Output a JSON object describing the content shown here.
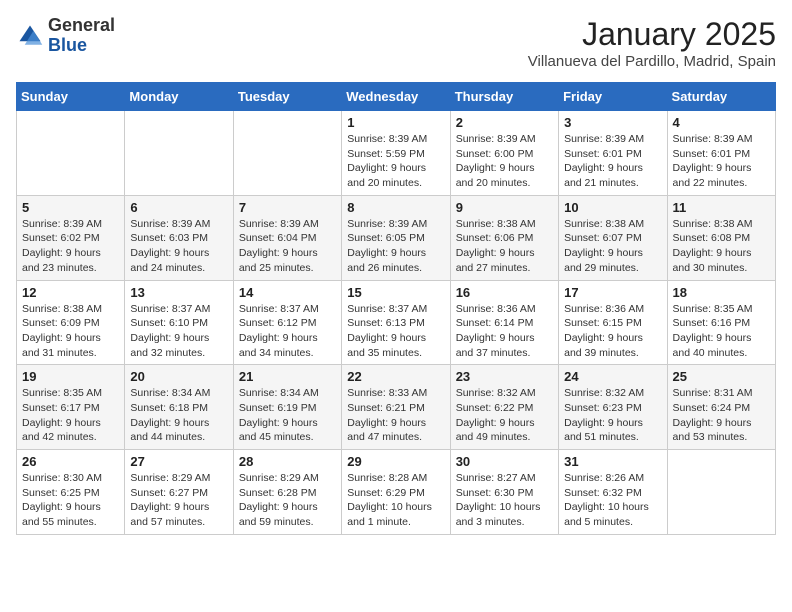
{
  "header": {
    "logo_line1": "General",
    "logo_line2": "Blue",
    "month": "January 2025",
    "location": "Villanueva del Pardillo, Madrid, Spain"
  },
  "days_of_week": [
    "Sunday",
    "Monday",
    "Tuesday",
    "Wednesday",
    "Thursday",
    "Friday",
    "Saturday"
  ],
  "weeks": [
    [
      {
        "day": "",
        "info": ""
      },
      {
        "day": "",
        "info": ""
      },
      {
        "day": "",
        "info": ""
      },
      {
        "day": "1",
        "info": "Sunrise: 8:39 AM\nSunset: 5:59 PM\nDaylight: 9 hours and 20 minutes."
      },
      {
        "day": "2",
        "info": "Sunrise: 8:39 AM\nSunset: 6:00 PM\nDaylight: 9 hours and 20 minutes."
      },
      {
        "day": "3",
        "info": "Sunrise: 8:39 AM\nSunset: 6:01 PM\nDaylight: 9 hours and 21 minutes."
      },
      {
        "day": "4",
        "info": "Sunrise: 8:39 AM\nSunset: 6:01 PM\nDaylight: 9 hours and 22 minutes."
      }
    ],
    [
      {
        "day": "5",
        "info": "Sunrise: 8:39 AM\nSunset: 6:02 PM\nDaylight: 9 hours and 23 minutes."
      },
      {
        "day": "6",
        "info": "Sunrise: 8:39 AM\nSunset: 6:03 PM\nDaylight: 9 hours and 24 minutes."
      },
      {
        "day": "7",
        "info": "Sunrise: 8:39 AM\nSunset: 6:04 PM\nDaylight: 9 hours and 25 minutes."
      },
      {
        "day": "8",
        "info": "Sunrise: 8:39 AM\nSunset: 6:05 PM\nDaylight: 9 hours and 26 minutes."
      },
      {
        "day": "9",
        "info": "Sunrise: 8:38 AM\nSunset: 6:06 PM\nDaylight: 9 hours and 27 minutes."
      },
      {
        "day": "10",
        "info": "Sunrise: 8:38 AM\nSunset: 6:07 PM\nDaylight: 9 hours and 29 minutes."
      },
      {
        "day": "11",
        "info": "Sunrise: 8:38 AM\nSunset: 6:08 PM\nDaylight: 9 hours and 30 minutes."
      }
    ],
    [
      {
        "day": "12",
        "info": "Sunrise: 8:38 AM\nSunset: 6:09 PM\nDaylight: 9 hours and 31 minutes."
      },
      {
        "day": "13",
        "info": "Sunrise: 8:37 AM\nSunset: 6:10 PM\nDaylight: 9 hours and 32 minutes."
      },
      {
        "day": "14",
        "info": "Sunrise: 8:37 AM\nSunset: 6:12 PM\nDaylight: 9 hours and 34 minutes."
      },
      {
        "day": "15",
        "info": "Sunrise: 8:37 AM\nSunset: 6:13 PM\nDaylight: 9 hours and 35 minutes."
      },
      {
        "day": "16",
        "info": "Sunrise: 8:36 AM\nSunset: 6:14 PM\nDaylight: 9 hours and 37 minutes."
      },
      {
        "day": "17",
        "info": "Sunrise: 8:36 AM\nSunset: 6:15 PM\nDaylight: 9 hours and 39 minutes."
      },
      {
        "day": "18",
        "info": "Sunrise: 8:35 AM\nSunset: 6:16 PM\nDaylight: 9 hours and 40 minutes."
      }
    ],
    [
      {
        "day": "19",
        "info": "Sunrise: 8:35 AM\nSunset: 6:17 PM\nDaylight: 9 hours and 42 minutes."
      },
      {
        "day": "20",
        "info": "Sunrise: 8:34 AM\nSunset: 6:18 PM\nDaylight: 9 hours and 44 minutes."
      },
      {
        "day": "21",
        "info": "Sunrise: 8:34 AM\nSunset: 6:19 PM\nDaylight: 9 hours and 45 minutes."
      },
      {
        "day": "22",
        "info": "Sunrise: 8:33 AM\nSunset: 6:21 PM\nDaylight: 9 hours and 47 minutes."
      },
      {
        "day": "23",
        "info": "Sunrise: 8:32 AM\nSunset: 6:22 PM\nDaylight: 9 hours and 49 minutes."
      },
      {
        "day": "24",
        "info": "Sunrise: 8:32 AM\nSunset: 6:23 PM\nDaylight: 9 hours and 51 minutes."
      },
      {
        "day": "25",
        "info": "Sunrise: 8:31 AM\nSunset: 6:24 PM\nDaylight: 9 hours and 53 minutes."
      }
    ],
    [
      {
        "day": "26",
        "info": "Sunrise: 8:30 AM\nSunset: 6:25 PM\nDaylight: 9 hours and 55 minutes."
      },
      {
        "day": "27",
        "info": "Sunrise: 8:29 AM\nSunset: 6:27 PM\nDaylight: 9 hours and 57 minutes."
      },
      {
        "day": "28",
        "info": "Sunrise: 8:29 AM\nSunset: 6:28 PM\nDaylight: 9 hours and 59 minutes."
      },
      {
        "day": "29",
        "info": "Sunrise: 8:28 AM\nSunset: 6:29 PM\nDaylight: 10 hours and 1 minute."
      },
      {
        "day": "30",
        "info": "Sunrise: 8:27 AM\nSunset: 6:30 PM\nDaylight: 10 hours and 3 minutes."
      },
      {
        "day": "31",
        "info": "Sunrise: 8:26 AM\nSunset: 6:32 PM\nDaylight: 10 hours and 5 minutes."
      },
      {
        "day": "",
        "info": ""
      }
    ]
  ]
}
